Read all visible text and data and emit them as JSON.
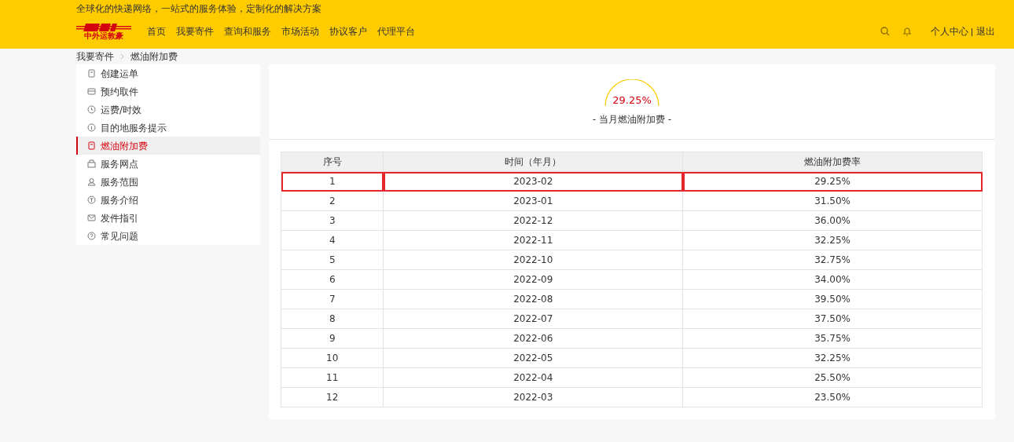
{
  "header": {
    "tagline": "全球化的快递网络，一站式的服务体验，定制化的解决方案",
    "logo_text": "中外运敦豪",
    "nav": [
      {
        "label": "首页",
        "selected": false
      },
      {
        "label": "我要寄件",
        "selected": false
      },
      {
        "label": "查询和服务",
        "selected": false
      },
      {
        "label": "市场活动",
        "selected": false
      },
      {
        "label": "协议客户",
        "selected": false
      },
      {
        "label": "代理平台",
        "selected": false
      }
    ],
    "user_links": [
      "个人中心",
      "退出"
    ]
  },
  "breadcrumb": [
    "我要寄件",
    "燃油附加费"
  ],
  "sidebar": {
    "items": [
      {
        "label": "创建运单",
        "selected": false
      },
      {
        "label": "预约取件",
        "selected": false
      },
      {
        "label": "运费/时效",
        "selected": false
      },
      {
        "label": "目的地服务提示",
        "selected": false
      },
      {
        "label": "燃油附加费",
        "selected": true
      },
      {
        "label": "服务网点",
        "selected": false
      },
      {
        "label": "服务范围",
        "selected": false
      },
      {
        "label": "服务介绍",
        "selected": false
      },
      {
        "label": "发件指引",
        "selected": false
      },
      {
        "label": "常见问题",
        "selected": false
      }
    ]
  },
  "summary": {
    "value": "29.25%",
    "caption": "- 当月燃油附加费 -"
  },
  "table": {
    "columns": [
      "序号",
      "时间（年月）",
      "燃油附加费率"
    ],
    "rows": [
      {
        "cells": [
          "1",
          "2023-02",
          "29.25%"
        ],
        "highlighted": true
      },
      {
        "cells": [
          "2",
          "2023-01",
          "31.50%"
        ],
        "highlighted": false
      },
      {
        "cells": [
          "3",
          "2022-12",
          "36.00%"
        ],
        "highlighted": false
      },
      {
        "cells": [
          "4",
          "2022-11",
          "32.25%"
        ],
        "highlighted": false
      },
      {
        "cells": [
          "5",
          "2022-10",
          "32.75%"
        ],
        "highlighted": false
      },
      {
        "cells": [
          "6",
          "2022-09",
          "34.00%"
        ],
        "highlighted": false
      },
      {
        "cells": [
          "7",
          "2022-08",
          "39.50%"
        ],
        "highlighted": false
      },
      {
        "cells": [
          "8",
          "2022-07",
          "37.50%"
        ],
        "highlighted": false
      },
      {
        "cells": [
          "9",
          "2022-06",
          "35.75%"
        ],
        "highlighted": false
      },
      {
        "cells": [
          "10",
          "2022-05",
          "32.25%"
        ],
        "highlighted": false
      },
      {
        "cells": [
          "11",
          "2022-04",
          "25.50%"
        ],
        "highlighted": false
      },
      {
        "cells": [
          "12",
          "2022-03",
          "23.50%"
        ],
        "highlighted": false
      }
    ]
  }
}
